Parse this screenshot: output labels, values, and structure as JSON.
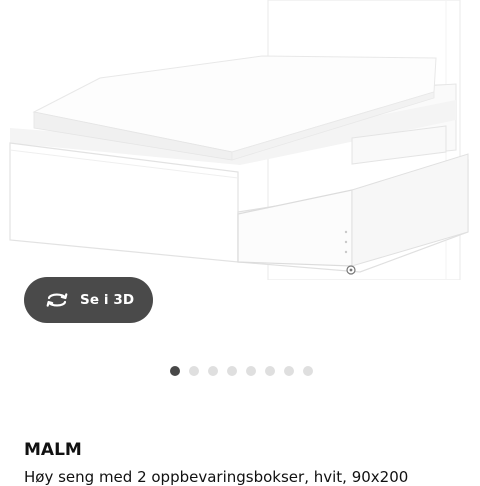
{
  "view_3d_button": {
    "label": "Se i 3D",
    "icon": "rotate-3d-icon"
  },
  "carousel": {
    "total_images": 8,
    "active_index": 0
  },
  "product": {
    "name": "MALM",
    "description": "Høy seng med 2 oppbevaringsbokser, hvit, 90x200"
  },
  "colors": {
    "button_bg": "#4a4a4a",
    "dot_active": "#484848",
    "dot_inactive": "#dfdfdf",
    "text": "#111111"
  }
}
